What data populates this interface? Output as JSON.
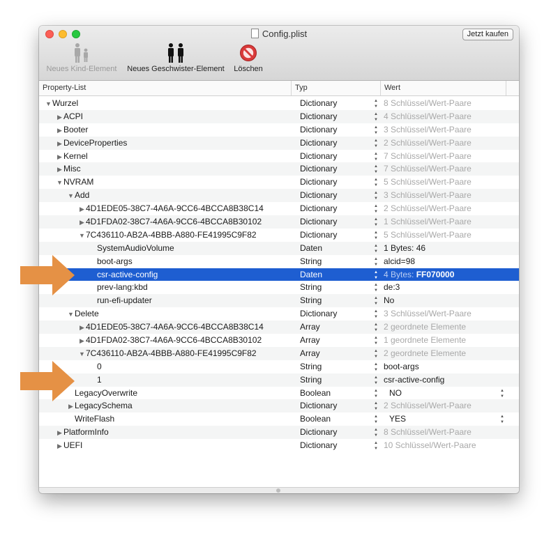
{
  "window": {
    "title": "Config.plist",
    "buy_button": "Jetzt kaufen"
  },
  "toolbar": {
    "new_child": "Neues Kind-Element",
    "new_sibling": "Neues Geschwister-Element",
    "delete": "Löschen"
  },
  "columns": {
    "key": "Property-List",
    "type": "Typ",
    "value": "Wert"
  },
  "rows": [
    {
      "key": "Wurzel",
      "level": 0,
      "disc": "open",
      "type": "Dictionary",
      "pre": "",
      "val": "",
      "gray": "8 Schlüssel/Wert-Paare"
    },
    {
      "key": "ACPI",
      "level": 1,
      "disc": "closed",
      "type": "Dictionary",
      "pre": "",
      "val": "",
      "gray": "4 Schlüssel/Wert-Paare"
    },
    {
      "key": "Booter",
      "level": 1,
      "disc": "closed",
      "type": "Dictionary",
      "pre": "",
      "val": "",
      "gray": "3 Schlüssel/Wert-Paare"
    },
    {
      "key": "DeviceProperties",
      "level": 1,
      "disc": "closed",
      "type": "Dictionary",
      "pre": "",
      "val": "",
      "gray": "2 Schlüssel/Wert-Paare"
    },
    {
      "key": "Kernel",
      "level": 1,
      "disc": "closed",
      "type": "Dictionary",
      "pre": "",
      "val": "",
      "gray": "7 Schlüssel/Wert-Paare"
    },
    {
      "key": "Misc",
      "level": 1,
      "disc": "closed",
      "type": "Dictionary",
      "pre": "",
      "val": "",
      "gray": "7 Schlüssel/Wert-Paare"
    },
    {
      "key": "NVRAM",
      "level": 1,
      "disc": "open",
      "type": "Dictionary",
      "pre": "",
      "val": "",
      "gray": "5 Schlüssel/Wert-Paare"
    },
    {
      "key": "Add",
      "level": 2,
      "disc": "open",
      "type": "Dictionary",
      "pre": "",
      "val": "",
      "gray": "3 Schlüssel/Wert-Paare"
    },
    {
      "key": "4D1EDE05-38C7-4A6A-9CC6-4BCCA8B38C14",
      "level": 3,
      "disc": "closed",
      "type": "Dictionary",
      "pre": "",
      "val": "",
      "gray": "2 Schlüssel/Wert-Paare"
    },
    {
      "key": "4D1FDA02-38C7-4A6A-9CC6-4BCCA8B30102",
      "level": 3,
      "disc": "closed",
      "type": "Dictionary",
      "pre": "",
      "val": "",
      "gray": "1 Schlüssel/Wert-Paare"
    },
    {
      "key": "7C436110-AB2A-4BBB-A880-FE41995C9F82",
      "level": 3,
      "disc": "open",
      "type": "Dictionary",
      "pre": "",
      "val": "",
      "gray": "5 Schlüssel/Wert-Paare"
    },
    {
      "key": "SystemAudioVolume",
      "level": 4,
      "disc": "none",
      "type": "Daten",
      "pre": "1 Bytes: ",
      "val": "46",
      "gray": ""
    },
    {
      "key": "boot-args",
      "level": 4,
      "disc": "none",
      "type": "String",
      "pre": "",
      "val": "alcid=98",
      "gray": ""
    },
    {
      "key": "csr-active-config",
      "level": 4,
      "disc": "none",
      "type": "Daten",
      "pre": "4 Bytes: ",
      "val": "FF070000",
      "gray": "",
      "selected": true
    },
    {
      "key": "prev-lang:kbd",
      "level": 4,
      "disc": "none",
      "type": "String",
      "pre": "",
      "val": "de:3",
      "gray": ""
    },
    {
      "key": "run-efi-updater",
      "level": 4,
      "disc": "none",
      "type": "String",
      "pre": "",
      "val": "No",
      "gray": ""
    },
    {
      "key": "Delete",
      "level": 2,
      "disc": "open",
      "type": "Dictionary",
      "pre": "",
      "val": "",
      "gray": "3 Schlüssel/Wert-Paare"
    },
    {
      "key": "4D1EDE05-38C7-4A6A-9CC6-4BCCA8B38C14",
      "level": 3,
      "disc": "closed",
      "type": "Array",
      "pre": "",
      "val": "",
      "gray": "2 geordnete Elemente"
    },
    {
      "key": "4D1FDA02-38C7-4A6A-9CC6-4BCCA8B30102",
      "level": 3,
      "disc": "closed",
      "type": "Array",
      "pre": "",
      "val": "",
      "gray": "1 geordnete Elemente"
    },
    {
      "key": "7C436110-AB2A-4BBB-A880-FE41995C9F82",
      "level": 3,
      "disc": "open",
      "type": "Array",
      "pre": "",
      "val": "",
      "gray": "2 geordnete Elemente"
    },
    {
      "key": "0",
      "level": 4,
      "disc": "none",
      "type": "String",
      "pre": "",
      "val": "boot-args",
      "gray": ""
    },
    {
      "key": "1",
      "level": 4,
      "disc": "none",
      "type": "String",
      "pre": "",
      "val": "csr-active-config",
      "gray": ""
    },
    {
      "key": "LegacyOverwrite",
      "level": 2,
      "disc": "none",
      "type": "Boolean",
      "pre": "",
      "val": "NO",
      "gray": "",
      "popup": true
    },
    {
      "key": "LegacySchema",
      "level": 2,
      "disc": "closed",
      "type": "Dictionary",
      "pre": "",
      "val": "",
      "gray": "2 Schlüssel/Wert-Paare"
    },
    {
      "key": "WriteFlash",
      "level": 2,
      "disc": "none",
      "type": "Boolean",
      "pre": "",
      "val": "YES",
      "gray": "",
      "popup": true
    },
    {
      "key": "PlatformInfo",
      "level": 1,
      "disc": "closed",
      "type": "Dictionary",
      "pre": "",
      "val": "",
      "gray": "8 Schlüssel/Wert-Paare"
    },
    {
      "key": "UEFI",
      "level": 1,
      "disc": "closed",
      "type": "Dictionary",
      "pre": "",
      "val": "",
      "gray": "10 Schlüssel/Wert-Paare"
    }
  ],
  "colors": {
    "selection": "#1e5ed1",
    "annotation_arrow": "#e59145"
  }
}
